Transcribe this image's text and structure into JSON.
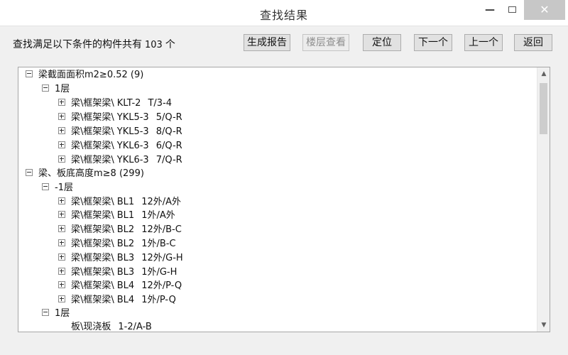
{
  "window": {
    "title": "查找结果",
    "minimize_glyph": "—",
    "close_glyph": "✕"
  },
  "summary": {
    "prefix": "查找满足以下条件的构件共有",
    "count": "103",
    "suffix": "个"
  },
  "toolbar": {
    "generate_report": "生成报告",
    "floor_view": "楼层查看",
    "locate": "定位",
    "next": "下一个",
    "previous": "上一个",
    "back": "返回"
  },
  "tree": {
    "groups": [
      {
        "label": "梁截面面积m2≥0.52 (9)",
        "floors": [
          {
            "label": "1层",
            "items": [
              {
                "type": "梁\\框架梁\\",
                "code": "KLT-2",
                "loc": "T/3-4"
              },
              {
                "type": "梁\\框架梁\\",
                "code": "YKL5-3",
                "loc": "5/Q-R"
              },
              {
                "type": "梁\\框架梁\\",
                "code": "YKL5-3",
                "loc": "8/Q-R"
              },
              {
                "type": "梁\\框架梁\\",
                "code": "YKL6-3",
                "loc": "6/Q-R"
              },
              {
                "type": "梁\\框架梁\\",
                "code": "YKL6-3",
                "loc": "7/Q-R"
              }
            ]
          }
        ]
      },
      {
        "label": "梁、板底高度m≥8 (299)",
        "floors": [
          {
            "label": "-1层",
            "items": [
              {
                "type": "梁\\框架梁\\",
                "code": "BL1",
                "loc": "12外/A外"
              },
              {
                "type": "梁\\框架梁\\",
                "code": "BL1",
                "loc": "1外/A外"
              },
              {
                "type": "梁\\框架梁\\",
                "code": "BL2",
                "loc": "12外/B-C"
              },
              {
                "type": "梁\\框架梁\\",
                "code": "BL2",
                "loc": "1外/B-C"
              },
              {
                "type": "梁\\框架梁\\",
                "code": "BL3",
                "loc": "12外/G-H"
              },
              {
                "type": "梁\\框架梁\\",
                "code": "BL3",
                "loc": "1外/G-H"
              },
              {
                "type": "梁\\框架梁\\",
                "code": "BL4",
                "loc": "12外/P-Q"
              },
              {
                "type": "梁\\框架梁\\",
                "code": "BL4",
                "loc": "1外/P-Q"
              }
            ]
          },
          {
            "label": "1层",
            "items": [
              {
                "type": "板\\现浇板",
                "code": "",
                "loc": "1-2/A-B"
              }
            ]
          }
        ]
      }
    ]
  },
  "scrollbar": {
    "up_glyph": "▲",
    "down_glyph": "▼"
  }
}
